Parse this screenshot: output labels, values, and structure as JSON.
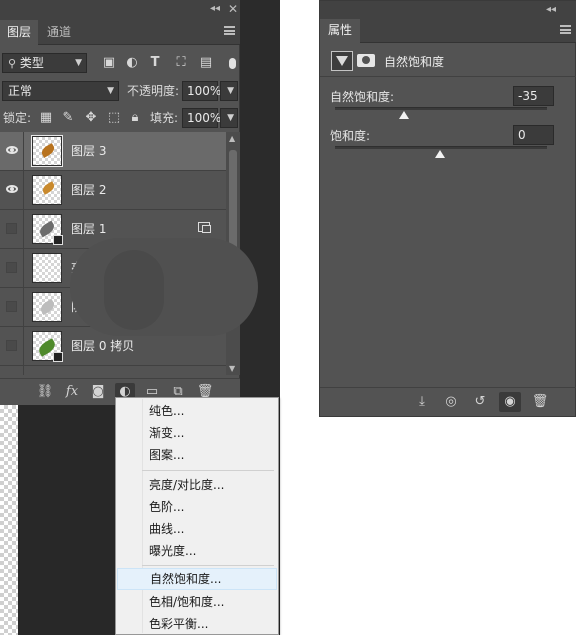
{
  "layers_panel": {
    "tabs": [
      "图层",
      "通道"
    ],
    "filter_type": "类型",
    "blend_mode": "正常",
    "opacity_label": "不透明度:",
    "opacity_value": "100%",
    "lock_label": "锁定:",
    "fill_label": "填充:",
    "fill_value": "100%",
    "layers": [
      {
        "name": "图层 3",
        "visible": true,
        "selected": true
      },
      {
        "name": "图层 2",
        "visible": true,
        "selected": false
      },
      {
        "name": "图层 1",
        "visible": false,
        "selected": false
      },
      {
        "name": "亮光",
        "visible": false,
        "selected": false
      },
      {
        "name": "阴影",
        "visible": false,
        "selected": false
      },
      {
        "name": "图层 0 拷贝",
        "visible": false,
        "selected": false
      }
    ]
  },
  "adjustment_menu": {
    "items": [
      "纯色...",
      "渐变...",
      "图案...",
      "亮度/对比度...",
      "色阶...",
      "曲线...",
      "曝光度...",
      "自然饱和度...",
      "色相/饱和度...",
      "色彩平衡..."
    ],
    "highlighted": "自然饱和度..."
  },
  "properties_panel": {
    "tab": "属性",
    "adjustment_title": "自然饱和度",
    "vibrance_label": "自然饱和度:",
    "vibrance_value": "-35",
    "saturation_label": "饱和度:",
    "saturation_value": "0"
  },
  "colors": {
    "panel_bg": "#535353",
    "panel_dark": "#424242",
    "menu_bg": "#f0f0f0",
    "menu_highlight": "#e5f1fb"
  }
}
